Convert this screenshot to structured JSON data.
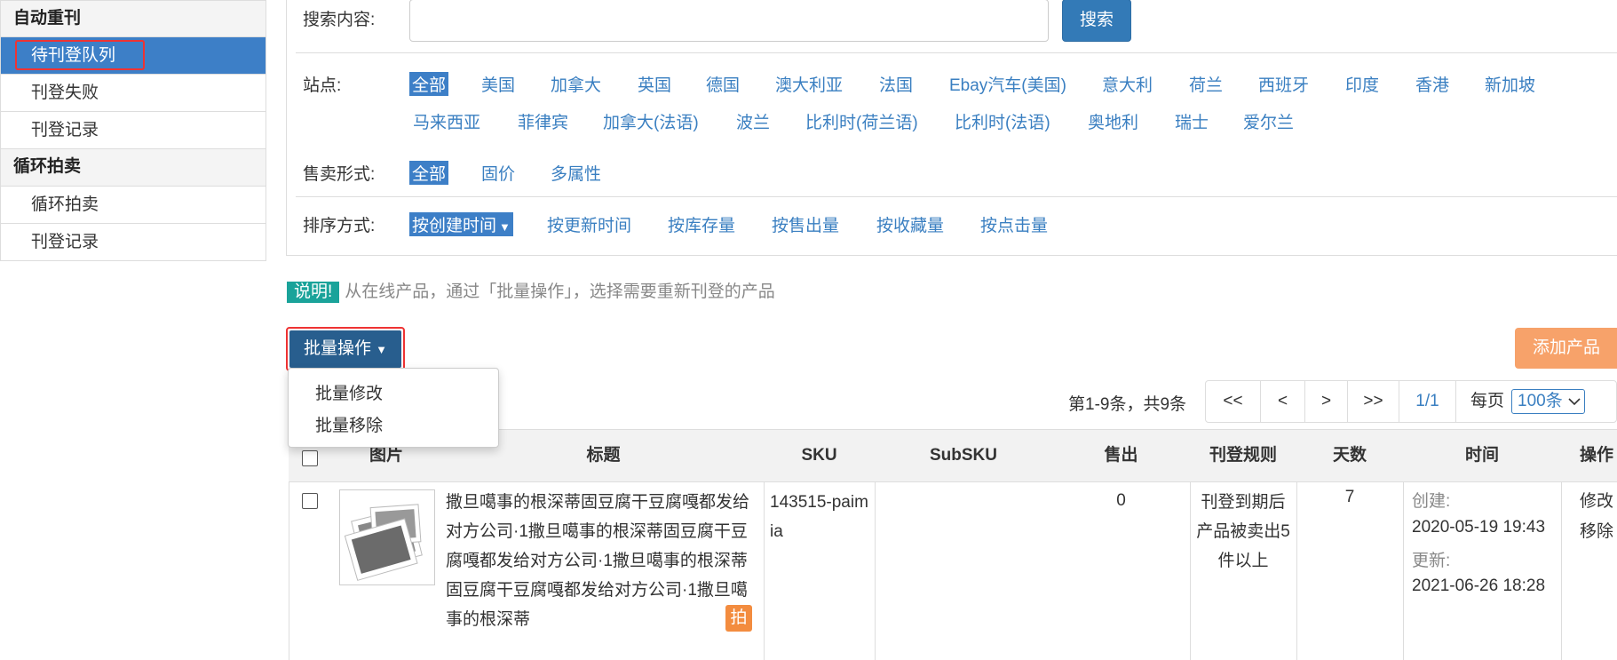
{
  "sidebar": {
    "groups": [
      {
        "label": "自动重刊",
        "items": [
          "待刊登队列",
          "刊登失败",
          "刊登记录"
        ]
      },
      {
        "label": "循环拍卖",
        "items": [
          "循环拍卖",
          "刊登记录"
        ]
      }
    ]
  },
  "filters": {
    "search_label": "搜索内容:",
    "search_value": "",
    "search_button": "搜索",
    "site_label": "站点:",
    "sites": [
      "全部",
      "美国",
      "加拿大",
      "英国",
      "德国",
      "澳大利亚",
      "法国",
      "Ebay汽车(美国)",
      "意大利",
      "荷兰",
      "西班牙",
      "印度",
      "香港",
      "新加坡",
      "马来西亚",
      "菲律宾",
      "加拿大(法语)",
      "波兰",
      "比利时(荷兰语)",
      "比利时(法语)",
      "奥地利",
      "瑞士",
      "爱尔兰"
    ],
    "sale_label": "售卖形式:",
    "sale_types": [
      "全部",
      "固价",
      "多属性"
    ],
    "sort_label": "排序方式:",
    "sorts": [
      "按创建时间",
      "按更新时间",
      "按库存量",
      "按售出量",
      "按收藏量",
      "按点击量"
    ]
  },
  "info": {
    "tag": "说明!",
    "text": "从在线产品，通过「批量操作」，选择需要重新刊登的产品"
  },
  "batch": {
    "label": "批量操作",
    "menu": [
      "批量修改",
      "批量移除"
    ]
  },
  "add_product": "添加产品",
  "pagination": {
    "info": "第1-9条，共9条",
    "first": "<<",
    "prev": "<",
    "next": ">",
    "last": ">>",
    "current": "1/1",
    "per_label": "每页",
    "per_value": "100条"
  },
  "table": {
    "headers": [
      "图片",
      "标题",
      "SKU",
      "SubSKU",
      "售出",
      "刊登规则",
      "天数",
      "时间",
      "操作"
    ],
    "row": {
      "title": "撒旦噶事的根深蒂固豆腐干豆腐嘎都发给对方公司·1撒旦噶事的根深蒂固豆腐干豆腐嘎都发给对方公司·1撒旦噶事的根深蒂固豆腐干豆腐嘎都发给对方公司·1撒旦噶事的根深蒂",
      "badge": "拍",
      "sku": "143515-paimia",
      "subsku": "",
      "sold": "0",
      "rule": "刊登到期后产品被卖出5件以上",
      "days": "7",
      "created_label": "创建:",
      "created": "2020-05-19 19:43",
      "updated_label": "更新:",
      "updated": "2021-06-26 18:28",
      "actions": [
        "修改",
        "移除"
      ]
    }
  },
  "colors": {
    "primary": "#337ab7",
    "active": "#3d7fc7",
    "link": "#3a7fc1",
    "info_tag": "#1aa39a",
    "add_button": "#f7a26a",
    "badge": "#f38c3f",
    "highlight": "#e33333"
  }
}
